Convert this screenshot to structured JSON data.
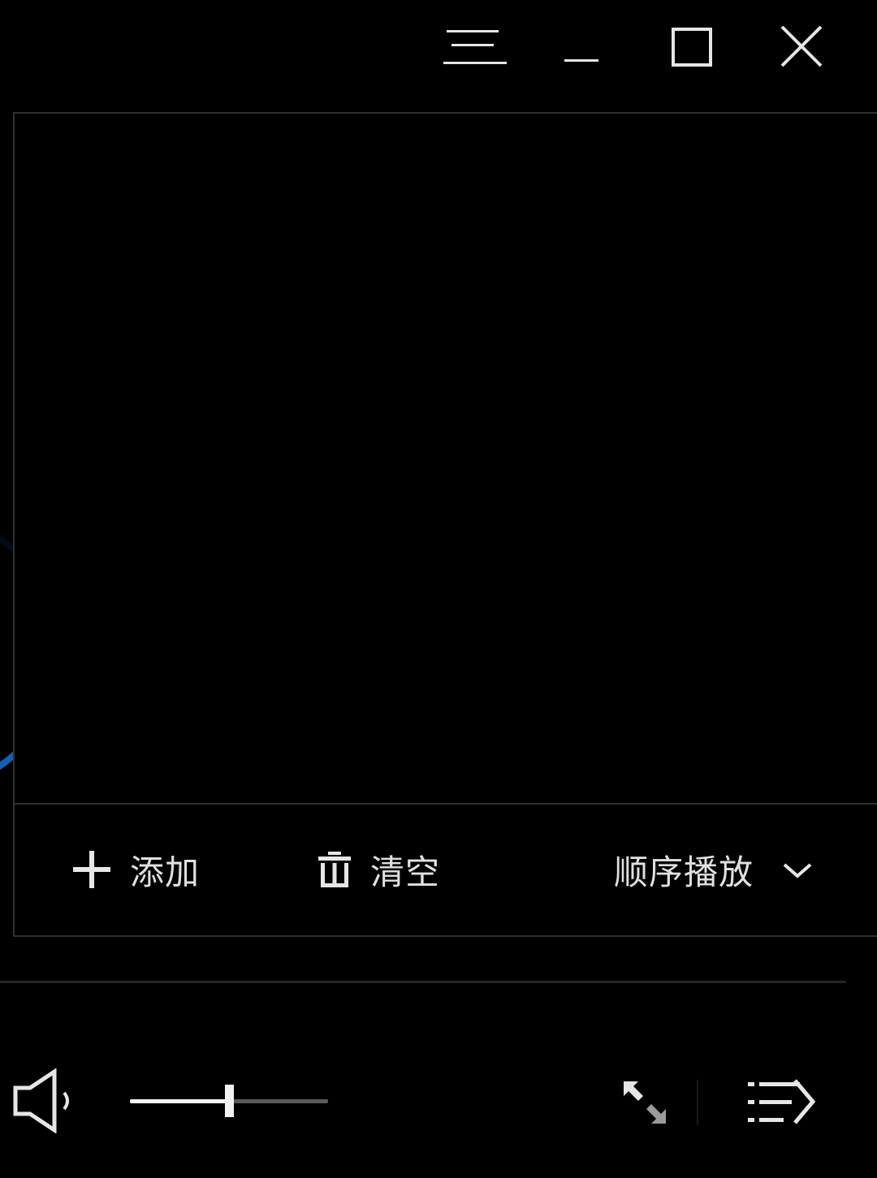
{
  "titlebar": {
    "icons": [
      "menu-icon",
      "minimize-icon",
      "maximize-icon",
      "close-icon"
    ]
  },
  "playlist": {
    "add_label": "添加",
    "clear_label": "清空",
    "play_mode_label": "顺序播放",
    "icons": [
      "plus-icon",
      "trash-icon",
      "chevron-down-icon"
    ]
  },
  "controls": {
    "volume_level": 0.5,
    "icons": [
      "volume-icon",
      "fullscreen-icon",
      "playlist-toggle-icon"
    ]
  },
  "colors": {
    "background": "#000000",
    "border": "#2f2f2f",
    "accent_arc": "#1565c0",
    "icon": "#e6e6e6"
  }
}
